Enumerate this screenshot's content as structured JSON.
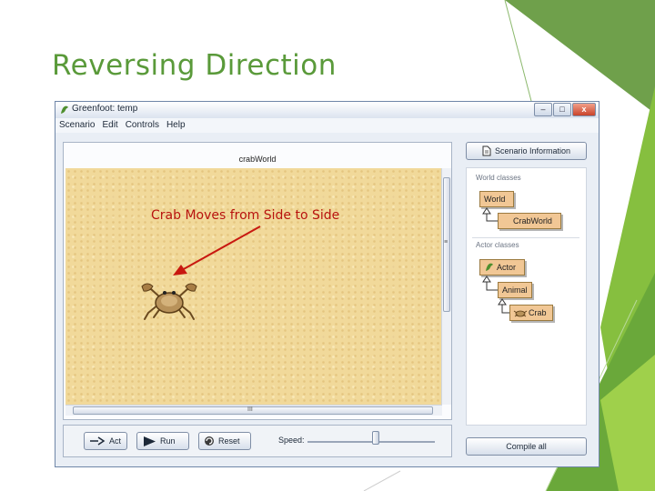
{
  "slide": {
    "title": "Reversing Direction"
  },
  "window": {
    "title": "Greenfoot: temp",
    "minimize_glyph": "–",
    "maximize_glyph": "□",
    "close_glyph": "x",
    "menu": [
      "Scenario",
      "Edit",
      "Controls",
      "Help"
    ]
  },
  "world": {
    "title": "crabWorld",
    "annotation": "Crab Moves from Side to Side",
    "hscroll_glyph": "III",
    "vscroll_glyph": "≡"
  },
  "controls": {
    "act": "Act",
    "run": "Run",
    "reset": "Reset",
    "speed": "Speed:"
  },
  "side": {
    "scenario_info": "Scenario Information",
    "world_classes": "World classes",
    "actor_classes": "Actor classes",
    "classes": {
      "world": "World",
      "crabworld": "CrabWorld",
      "actor": "Actor",
      "animal": "Animal",
      "crab": "Crab"
    },
    "compile": "Compile all"
  },
  "colors": {
    "title_green": "#5a9a3a",
    "annotation_red": "#b8130e",
    "class_fill": "#f1c795",
    "world_sand": "#f1d99a"
  },
  "icons": {
    "app": "greenfoot-logo-icon",
    "act": "act-step-icon",
    "run": "play-icon",
    "reset": "reset-icon",
    "scenario": "document-icon",
    "actor": "greenfoot-logo-icon",
    "crab": "crab-icon"
  }
}
